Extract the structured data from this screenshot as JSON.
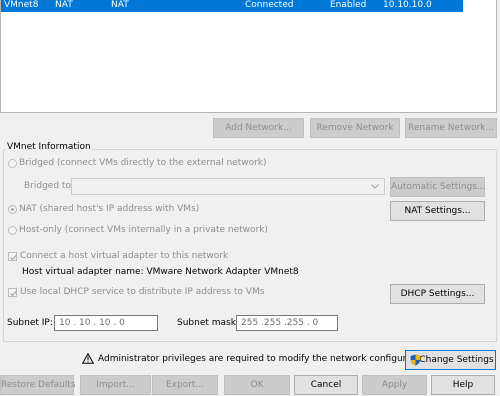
{
  "network_list": {
    "selected_row": {
      "name": "VMnet8",
      "type": "NAT",
      "external": "NAT",
      "host_connection": "Connected",
      "dhcp": "Enabled",
      "subnet": "10.10.10.0"
    }
  },
  "list_buttons": {
    "add": "Add Network...",
    "remove": "Remove Network",
    "rename": "Rename Network..."
  },
  "vmnet_info": {
    "group_title": "VMnet Information",
    "bridged_label": "Bridged (connect VMs directly to the external network)",
    "bridged_to_label": "Bridged to:",
    "bridged_to_value": "",
    "automatic_settings": "Automatic Settings...",
    "nat_label": "NAT (shared host's IP address with VMs)",
    "nat_settings": "NAT Settings...",
    "hostonly_label": "Host-only (connect VMs internally in a private network)",
    "connect_adapter_label": "Connect a host virtual adapter to this network",
    "adapter_name_text": "Host virtual adapter name: VMware Network Adapter VMnet8",
    "dhcp_label": "Use local DHCP service to distribute IP address to VMs",
    "dhcp_settings": "DHCP Settings...",
    "subnet_ip_label": "Subnet IP:",
    "subnet_ip_value": "10 . 10 . 10 . 0",
    "subnet_mask_label": "Subnet mask:",
    "subnet_mask_value": "255 .255 .255 . 0",
    "selected_mode": "NAT",
    "connect_adapter_checked": true,
    "dhcp_checked": true
  },
  "admin_notice": {
    "text": "Administrator privileges are required to modify the network configuration.",
    "change_settings": "Change Settings"
  },
  "footer_buttons": {
    "restore": "Restore Defaults",
    "import": "Import...",
    "export": "Export...",
    "ok": "OK",
    "cancel": "Cancel",
    "apply": "Apply",
    "help": "Help"
  },
  "colors": {
    "selection": "#0078d7",
    "disabled_text": "#8d8d8d",
    "shield_blue": "#1f5fbf",
    "shield_gold": "#f2b705"
  }
}
